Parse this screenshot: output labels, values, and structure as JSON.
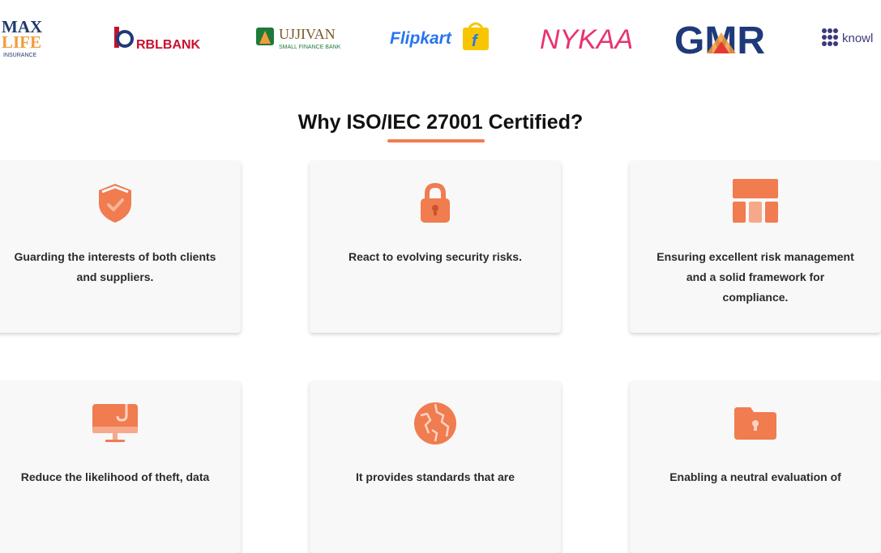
{
  "logos": [
    {
      "name": "max-life",
      "line1": "MAX",
      "line2": "LIFE",
      "line3": "INSURANCE"
    },
    {
      "name": "rbl-bank",
      "text": "RBLBANK"
    },
    {
      "name": "ujjivan",
      "line1": "UJJIVAN",
      "line2": "SMALL FINANCE BANK"
    },
    {
      "name": "flipkart",
      "text": "Flipkart"
    },
    {
      "name": "nykaa",
      "text": "NYKAA"
    },
    {
      "name": "gmr",
      "text": "GMR"
    },
    {
      "name": "knowlarity",
      "text": "knowl"
    }
  ],
  "section": {
    "heading": "Why ISO/IEC 27001 Certified?",
    "cards": [
      {
        "icon": "shield-icon",
        "text": "Guarding the interests of both clients and suppliers."
      },
      {
        "icon": "lock-icon",
        "text": "React to evolving security risks."
      },
      {
        "icon": "layout-blocks-icon",
        "text": "Ensuring excellent risk management and a solid framework for compliance."
      },
      {
        "icon": "monitor-hook-icon",
        "text": "Reduce the likelihood of theft, data"
      },
      {
        "icon": "globe-icon",
        "text": "It provides standards that are"
      },
      {
        "icon": "folder-lock-icon",
        "text": "Enabling a neutral evaluation of"
      }
    ]
  },
  "colors": {
    "accent": "#f07c50",
    "card_bg": "#f8f8f8"
  }
}
